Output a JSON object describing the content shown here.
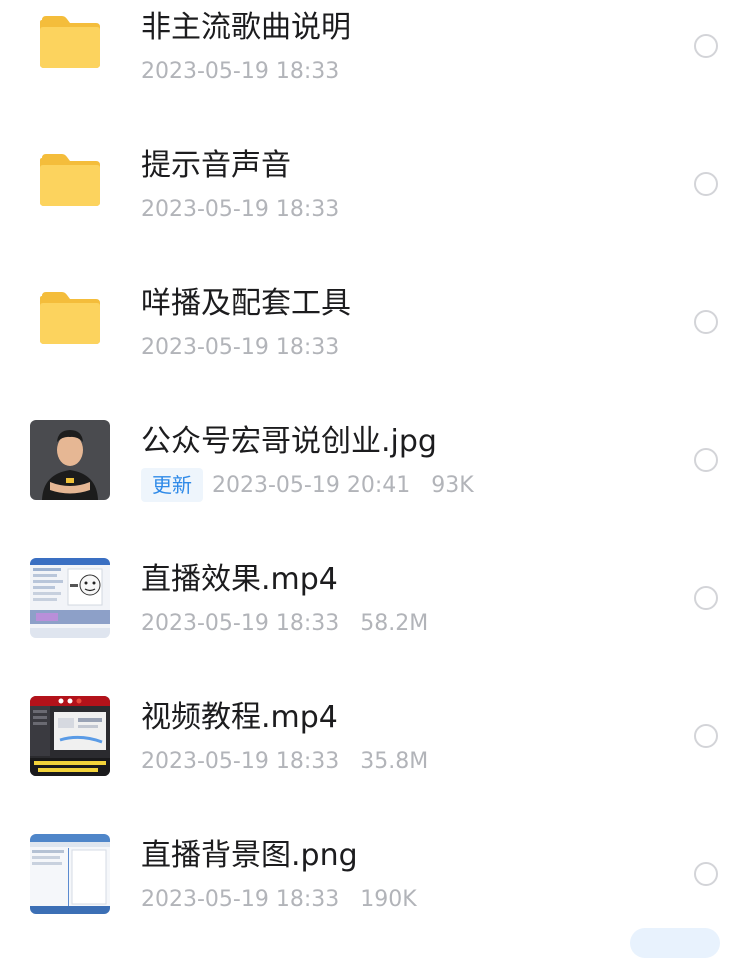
{
  "files": [
    {
      "kind": "folder",
      "icon": "folder-icon",
      "name": "非主流歌曲说明",
      "badge": "",
      "time": "2023-05-19 18:33",
      "size": ""
    },
    {
      "kind": "folder",
      "icon": "folder-icon",
      "name": "提示音声音",
      "badge": "",
      "time": "2023-05-19 18:33",
      "size": ""
    },
    {
      "kind": "folder",
      "icon": "folder-icon",
      "name": "咩播及配套工具",
      "badge": "",
      "time": "2023-05-19 18:33",
      "size": ""
    },
    {
      "kind": "image",
      "icon": "avatar-thumbnail",
      "name": "公众号宏哥说创业.jpg",
      "badge": "更新",
      "time": "2023-05-19 20:41",
      "size": "93K"
    },
    {
      "kind": "video",
      "icon": "video-thumbnail",
      "name": "直播效果.mp4",
      "badge": "",
      "time": "2023-05-19 18:33",
      "size": "58.2M"
    },
    {
      "kind": "video",
      "icon": "video-thumbnail",
      "name": "视频教程.mp4",
      "badge": "",
      "time": "2023-05-19 18:33",
      "size": "35.8M"
    },
    {
      "kind": "image",
      "icon": "image-thumbnail",
      "name": "直播背景图.png",
      "badge": "",
      "time": "2023-05-19 18:33",
      "size": "190K"
    }
  ],
  "colors": {
    "folder": "#fcd35e",
    "badge_text": "#2f8ae8",
    "meta_text": "#b2b4b9"
  }
}
